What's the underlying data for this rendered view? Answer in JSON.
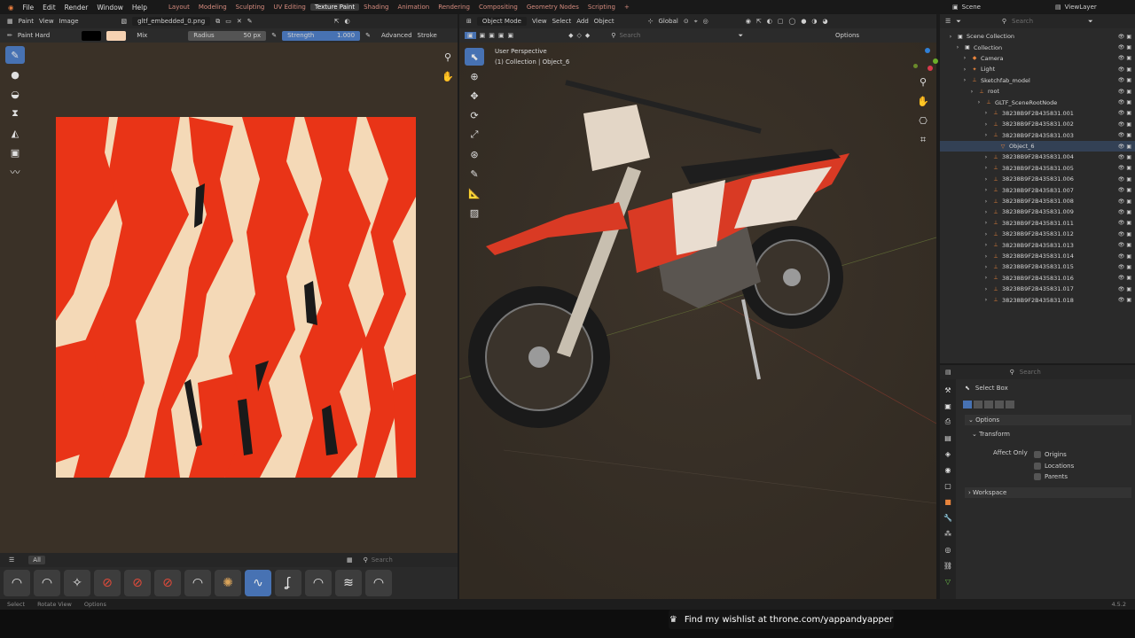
{
  "topbar": {
    "menus": [
      "File",
      "Edit",
      "Render",
      "Window",
      "Help"
    ],
    "workspaces": [
      "Layout",
      "Modeling",
      "Sculpting",
      "UV Editing",
      "Texture Paint",
      "Shading",
      "Animation",
      "Rendering",
      "Compositing",
      "Geometry Nodes",
      "Scripting"
    ],
    "active_workspace": "Texture Paint",
    "scene": "Scene",
    "view_layer": "ViewLayer"
  },
  "image_editor": {
    "mode": "Paint",
    "menus": [
      "View",
      "Image"
    ],
    "image_name": "gltf_embedded_0.png",
    "brush": "Paint Hard",
    "blend": "Mix",
    "radius_label": "Radius",
    "radius_value": "50 px",
    "strength_label": "Strength",
    "strength_value": "1.000",
    "advanced": "Advanced",
    "stroke": "Stroke",
    "shelf_tab": "All",
    "search_placeholder": "Search",
    "primary_color": "#000000",
    "secondary_color": "#f6d2b2"
  },
  "viewport": {
    "mode": "Object Mode",
    "menus": [
      "View",
      "Select",
      "Add",
      "Object"
    ],
    "orientation": "Global",
    "search_placeholder": "Search",
    "options": "Options",
    "perspective": "User Perspective",
    "collection_info": "(1) Collection | Object_6"
  },
  "outliner": {
    "search_placeholder": "Search",
    "items": [
      {
        "label": "Scene Collection",
        "depth": 0,
        "icon": "collection-icon"
      },
      {
        "label": "Collection",
        "depth": 1,
        "icon": "collection-icon"
      },
      {
        "label": "Camera",
        "depth": 2,
        "icon": "camera-icon"
      },
      {
        "label": "Light",
        "depth": 2,
        "icon": "light-icon"
      },
      {
        "label": "Sketchfab_model",
        "depth": 2,
        "icon": "empty-icon"
      },
      {
        "label": "root",
        "depth": 3,
        "icon": "empty-icon"
      },
      {
        "label": "GLTF_SceneRootNode",
        "depth": 4,
        "icon": "empty-icon"
      },
      {
        "label": "38238B9F2B435831.001",
        "depth": 5,
        "icon": "empty-icon"
      },
      {
        "label": "38238B9F2B435831.002",
        "depth": 5,
        "icon": "empty-icon"
      },
      {
        "label": "38238B9F2B435831.003",
        "depth": 5,
        "icon": "empty-icon"
      },
      {
        "label": "Object_6",
        "depth": 6,
        "icon": "mesh-icon"
      },
      {
        "label": "38238B9F2B435831.004",
        "depth": 5,
        "icon": "empty-icon"
      },
      {
        "label": "38238B9F2B435831.005",
        "depth": 5,
        "icon": "empty-icon"
      },
      {
        "label": "38238B9F2B435831.006",
        "depth": 5,
        "icon": "empty-icon"
      },
      {
        "label": "38238B9F2B435831.007",
        "depth": 5,
        "icon": "empty-icon"
      },
      {
        "label": "38238B9F2B435831.008",
        "depth": 5,
        "icon": "empty-icon"
      },
      {
        "label": "38238B9F2B435831.009",
        "depth": 5,
        "icon": "empty-icon"
      },
      {
        "label": "38238B9F2B435831.011",
        "depth": 5,
        "icon": "empty-icon"
      },
      {
        "label": "38238B9F2B435831.012",
        "depth": 5,
        "icon": "empty-icon"
      },
      {
        "label": "38238B9F2B435831.013",
        "depth": 5,
        "icon": "empty-icon"
      },
      {
        "label": "38238B9F2B435831.014",
        "depth": 5,
        "icon": "empty-icon"
      },
      {
        "label": "38238B9F2B435831.015",
        "depth": 5,
        "icon": "empty-icon"
      },
      {
        "label": "38238B9F2B435831.016",
        "depth": 5,
        "icon": "empty-icon"
      },
      {
        "label": "38238B9F2B435831.017",
        "depth": 5,
        "icon": "empty-icon"
      },
      {
        "label": "38238B9F2B435831.018",
        "depth": 5,
        "icon": "empty-icon"
      }
    ]
  },
  "properties": {
    "search_placeholder": "Search",
    "tool_name": "Select Box",
    "options_label": "Options",
    "transform_label": "Transform",
    "affect_only_label": "Affect Only",
    "affect_options": [
      "Origins",
      "Locations",
      "Parents"
    ],
    "workspace_label": "Workspace"
  },
  "statusbar": {
    "items": [
      "Select",
      "Rotate View",
      "Options"
    ],
    "version": "4.5.2"
  },
  "banner": {
    "text": "Find my wishlist at throne.com/yappandyapper"
  }
}
